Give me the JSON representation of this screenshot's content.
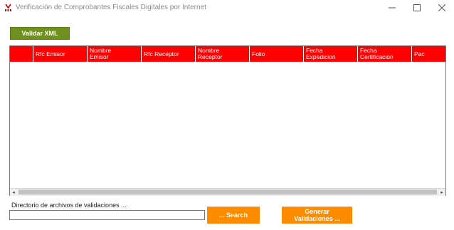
{
  "window": {
    "title": "Verificación de Comprobantes Fiscales Digitales por Internet",
    "icon": "app-logo-icon",
    "controls": {
      "minimize": "—",
      "maximize": "☐",
      "close": "✕"
    }
  },
  "toolbar": {
    "validar_label": "Validar XML"
  },
  "grid": {
    "columns": [
      "",
      "Rfc Emisor",
      "Nombre\nEmisor",
      "Rfc Receptor",
      "Nombre\nReceptor",
      "Folio",
      "Fecha\nExpedicion",
      "Fecha\nCertificacion",
      "Pac"
    ],
    "header_color": "#ff0000",
    "rows": [],
    "scroll": {
      "left_arrow": "◂",
      "right_arrow": "▸"
    }
  },
  "directory": {
    "label": "Directorio de archivos de validaciones ...",
    "value": "",
    "search_label": "... Search",
    "generate_label": "Generar\nValidaciones ..."
  },
  "colors": {
    "validar": "#6f8f1f",
    "accent": "#ff8c00"
  }
}
